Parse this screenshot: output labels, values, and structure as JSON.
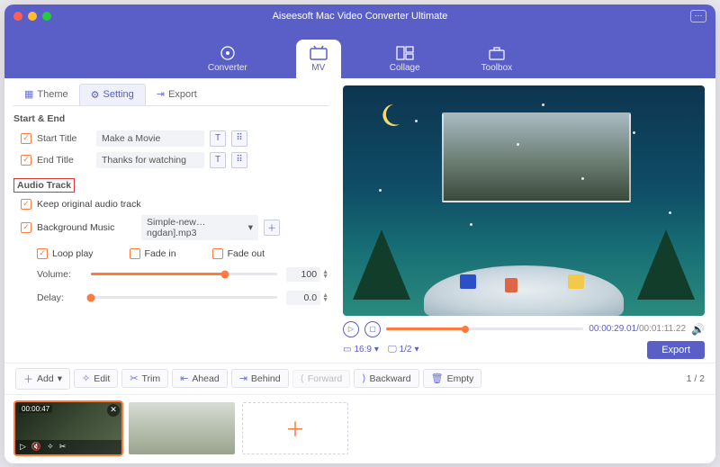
{
  "app_title": "Aiseesoft Mac Video Converter Ultimate",
  "nav": {
    "converter": "Converter",
    "mv": "MV",
    "collage": "Collage",
    "toolbox": "Toolbox"
  },
  "tabs": {
    "theme": "Theme",
    "setting": "Setting",
    "export": "Export"
  },
  "start_end": {
    "heading": "Start & End",
    "start_label": "Start Title",
    "start_value": "Make a Movie",
    "end_label": "End Title",
    "end_value": "Thanks for watching"
  },
  "audio": {
    "heading": "Audio Track",
    "keep_label": "Keep original audio track",
    "bgm_label": "Background Music",
    "bgm_value": "Simple-new…ngdan].mp3",
    "loop": "Loop play",
    "fade_in": "Fade in",
    "fade_out": "Fade out",
    "volume_label": "Volume:",
    "volume_value": "100",
    "delay_label": "Delay:",
    "delay_value": "0.0"
  },
  "player": {
    "current": "00:00:29.01",
    "total": "00:01:11.22",
    "aspect": "16:9",
    "page_of": "1/2",
    "export": "Export"
  },
  "toolbar": {
    "add": "Add",
    "edit": "Edit",
    "trim": "Trim",
    "ahead": "Ahead",
    "behind": "Behind",
    "forward": "Forward",
    "backward": "Backward",
    "empty": "Empty",
    "pager": "1 / 2"
  },
  "timeline": {
    "clip1_dur": "00:00:47"
  }
}
